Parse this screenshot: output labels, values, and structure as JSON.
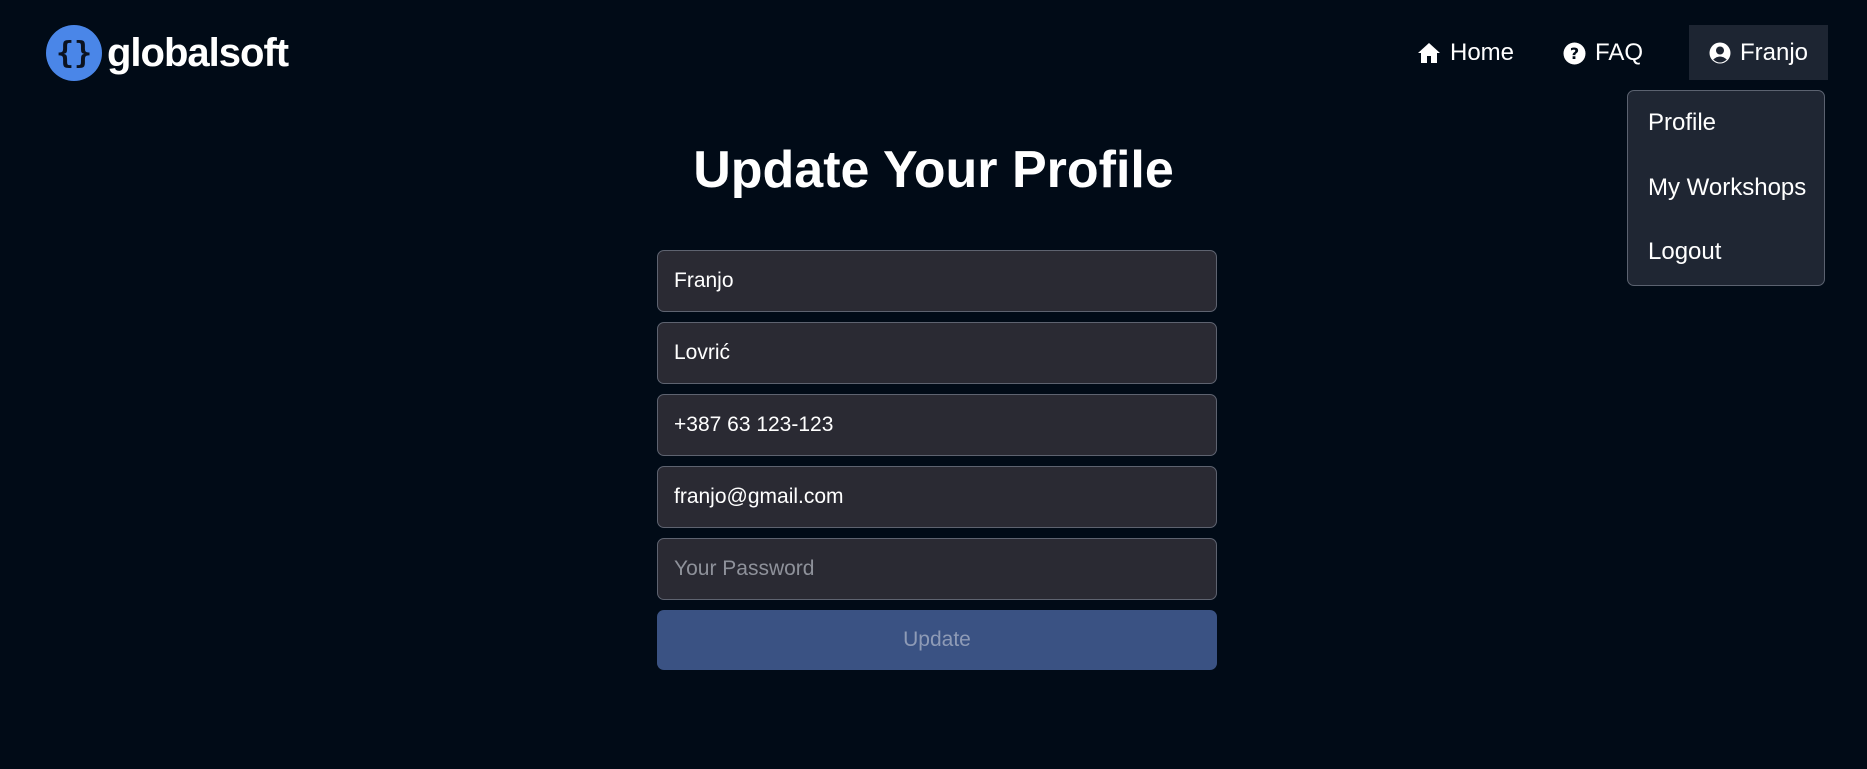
{
  "brand": {
    "name": "globalsoft",
    "logo_icon": "curly-braces-icon",
    "logo_color": "#4a86e8"
  },
  "nav": {
    "home": {
      "label": "Home",
      "icon": "home-icon"
    },
    "faq": {
      "label": "FAQ",
      "icon": "question-circle-icon"
    },
    "user": {
      "label": "Franjo",
      "icon": "user-circle-icon"
    }
  },
  "dropdown": {
    "items": [
      "Profile",
      "My Workshops",
      "Logout"
    ]
  },
  "form": {
    "title": "Update Your Profile",
    "first_name": "Franjo",
    "last_name": "Lovrić",
    "phone": "+387 63 123-123",
    "email": "franjo@gmail.com",
    "password_placeholder": "Your Password",
    "submit_label": "Update"
  },
  "colors": {
    "background": "#010b17",
    "input_bg": "#2a2a33",
    "button_bg": "#3a5283",
    "dropdown_bg": "#1f2633"
  }
}
